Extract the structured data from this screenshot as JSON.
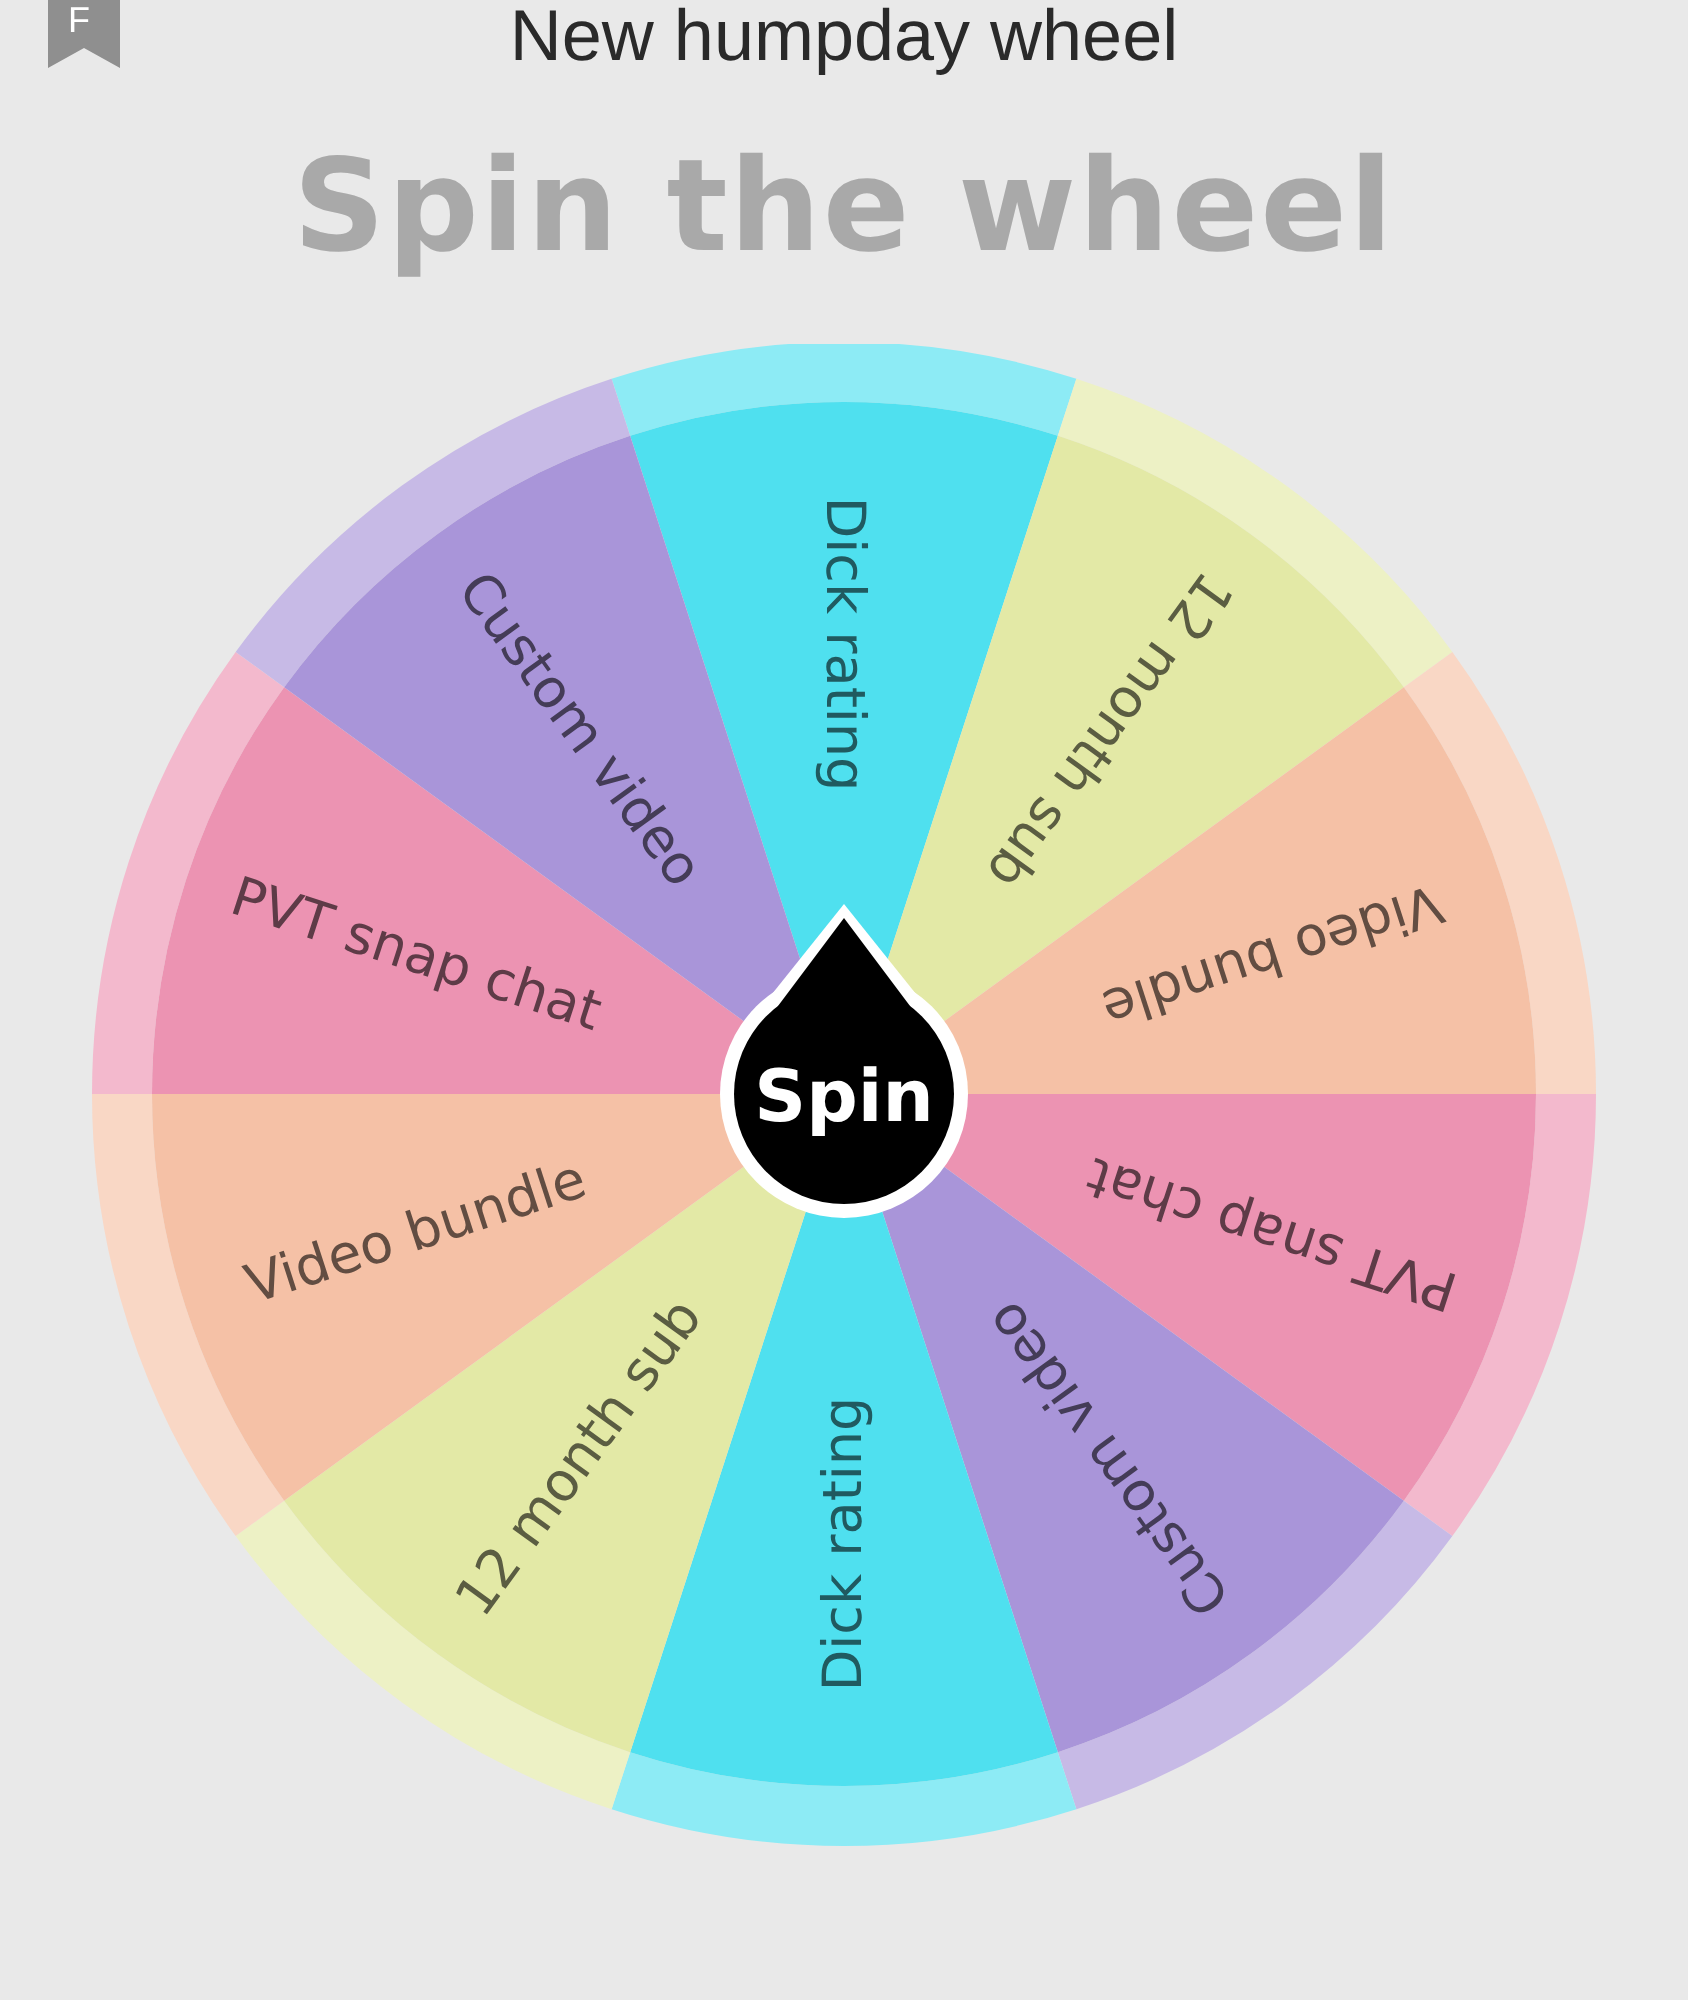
{
  "header": {
    "badge": "F",
    "title": "New humpday wheel"
  },
  "heading": "Spin the wheel",
  "wheel": {
    "segments": [
      {
        "label": "Dick rating",
        "color": "#4fe0ef"
      },
      {
        "label": "12 month sub",
        "color": "#e3e9a6"
      },
      {
        "label": "Video bundle",
        "color": "#f5c1a6"
      },
      {
        "label": "PVT snap chat",
        "color": "#ec93b2"
      },
      {
        "label": "Custom video",
        "color": "#a995d9"
      },
      {
        "label": "Dick rating",
        "color": "#4fe0ef"
      },
      {
        "label": "12 month sub",
        "color": "#e3e9a6"
      },
      {
        "label": "Video bundle",
        "color": "#f5c1a6"
      },
      {
        "label": "PVT snap chat",
        "color": "#ec93b2"
      },
      {
        "label": "Custom video",
        "color": "#a995d9"
      }
    ],
    "spin_label": "Spin"
  }
}
